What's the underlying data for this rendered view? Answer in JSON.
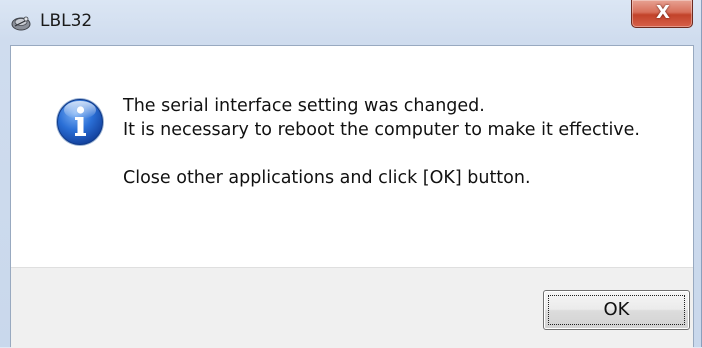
{
  "window": {
    "title": "LBL32",
    "app_icon": "lbl32-app-icon",
    "close_glyph": "X"
  },
  "dialog": {
    "icon": "information-icon",
    "message_lines": [
      "The serial interface setting was changed.",
      "It is necessary to reboot the computer to make it effective.",
      "Close other applications and click [OK] button."
    ]
  },
  "buttons": {
    "ok_label": "OK"
  },
  "colors": {
    "title_bar": "#cfdcee",
    "close_button": "#c2432a",
    "info_icon": "#1d5fc4",
    "footer": "#f0f0f0"
  }
}
